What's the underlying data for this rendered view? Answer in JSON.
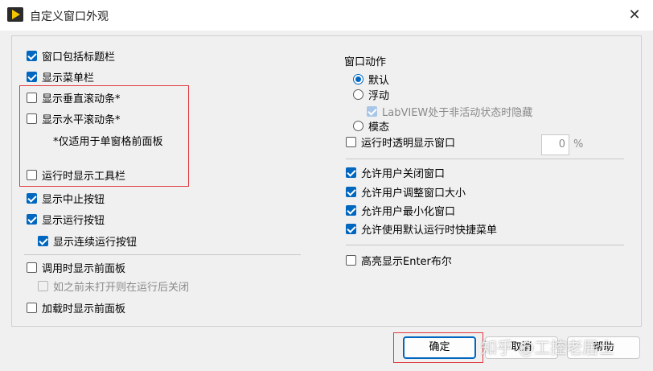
{
  "window": {
    "title": "自定义窗口外观"
  },
  "left": {
    "items": [
      {
        "label": "窗口包括标题栏",
        "checked": true
      },
      {
        "label": "显示菜单栏",
        "checked": true
      },
      {
        "label": "显示垂直滚动条*",
        "checked": false
      },
      {
        "label": "显示水平滚动条*",
        "checked": false
      },
      {
        "label": "运行时显示工具栏",
        "checked": false
      },
      {
        "label": "显示中止按钮",
        "checked": true
      },
      {
        "label": "显示运行按钮",
        "checked": true
      },
      {
        "label": "显示连续运行按钮",
        "checked": true
      },
      {
        "label": "调用时显示前面板",
        "checked": false
      },
      {
        "label": "如之前未打开则在运行后关闭",
        "checked": false,
        "disabled": true
      },
      {
        "label": "加载时显示前面板",
        "checked": false
      }
    ],
    "note": "*仅适用于单窗格前面板"
  },
  "right": {
    "window_action_label": "窗口动作",
    "radios": [
      {
        "label": "默认",
        "selected": true
      },
      {
        "label": "浮动",
        "selected": false
      },
      {
        "label": "模态",
        "selected": false
      }
    ],
    "hide_when_inactive": {
      "label": "LabVIEW处于非活动状态时隐藏",
      "checked": true,
      "disabled": true
    },
    "transparent": {
      "label": "运行时透明显示窗口",
      "checked": false
    },
    "transparency_value": "0",
    "transparency_unit": "%",
    "allow_items": [
      {
        "label": "允许用户关闭窗口",
        "checked": true
      },
      {
        "label": "允许用户调整窗口大小",
        "checked": true
      },
      {
        "label": "允许用户最小化窗口",
        "checked": true
      },
      {
        "label": "允许使用默认运行时快捷菜单",
        "checked": true
      }
    ],
    "highlight_enter": {
      "label": "高亮显示Enter布尔",
      "checked": false
    }
  },
  "buttons": {
    "ok": "确定",
    "cancel": "取消",
    "help": "帮助"
  },
  "watermark": "知乎 @工控老居士",
  "colors": {
    "accent": "#0067c0",
    "highlight_border": "#e0383e"
  }
}
